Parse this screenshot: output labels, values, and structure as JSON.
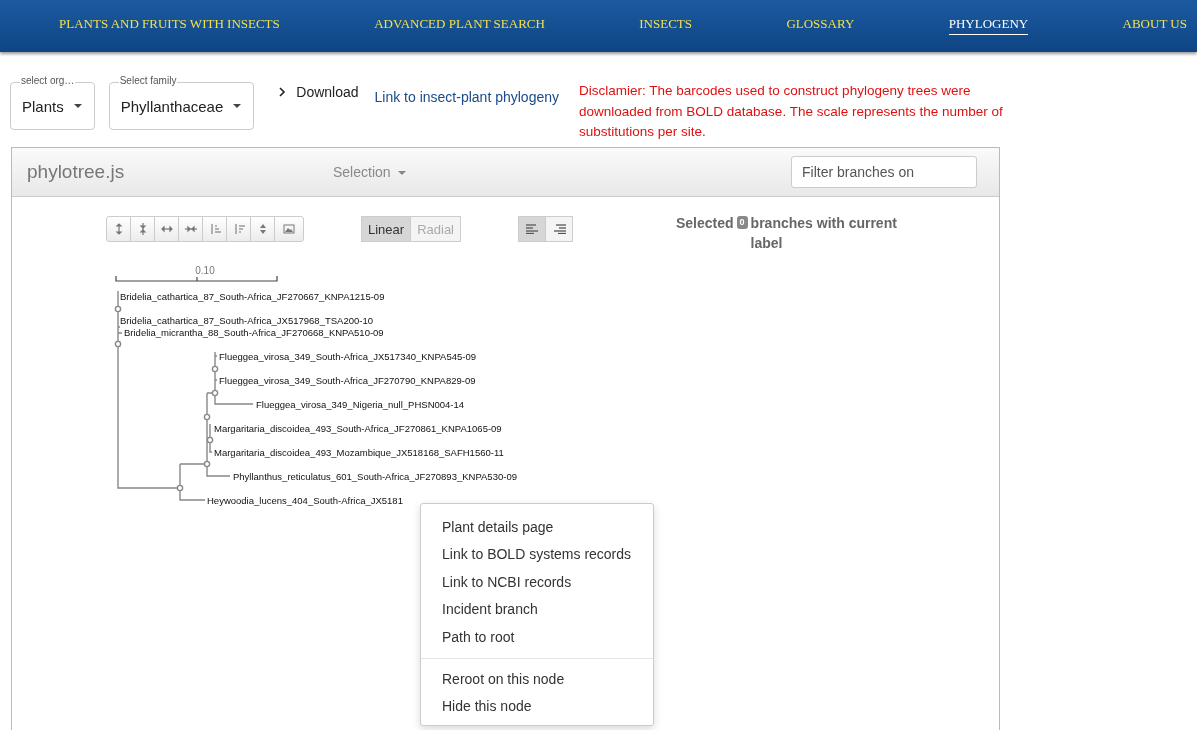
{
  "nav": {
    "items": [
      {
        "label": "PLANTS AND FRUITS WITH INSECTS",
        "selected": false
      },
      {
        "label": "ADVANCED PLANT SEARCH",
        "selected": false
      },
      {
        "label": "INSECTS",
        "selected": false
      },
      {
        "label": "GLOSSARY",
        "selected": false
      },
      {
        "label": "PHYLOGENY",
        "selected": true
      },
      {
        "label": "ABOUT US",
        "selected": false
      }
    ]
  },
  "organism_select": {
    "label": "select org…",
    "value": "Plants"
  },
  "family_select": {
    "label": "Select family",
    "value": "Phyllanthaceae"
  },
  "download": {
    "label": "Download",
    "expanded": false
  },
  "phylogeny_link": "Link to insect-plant phylogeny",
  "disclaimer": "Disclamier: The barcodes used to construct phylogeny trees were downloaded from BOLD database. The scale represents the number of substitutions per site.",
  "panel": {
    "title": "phylotree.js",
    "selection_menu": "Selection",
    "filter": {
      "placeholder": "Filter branches on"
    },
    "layout_toggle": [
      {
        "label": "Linear",
        "selected": true
      },
      {
        "label": "Radial",
        "selected": false
      }
    ],
    "align_toggle": [
      {
        "selected": true
      },
      {
        "selected": false
      }
    ],
    "selected_info": {
      "before": "Selected",
      "count": "0",
      "after": "branches with current label"
    },
    "tree": {
      "scale_label": "0.10",
      "leaves": [
        "Bridelia_cathartica_87_South-Africa_JF270667_KNPA1215-09",
        "Bridelia_cathartica_87_South-Africa_JX517968_TSA200-10",
        "Bridelia_micrantha_88_South-Africa_JF270668_KNPA510-09",
        "Flueggea_virosa_349_South-Africa_JX517340_KNPA545-09",
        "Flueggea_virosa_349_South-Africa_JF270790_KNPA829-09",
        "Flueggea_virosa_349_Nigeria_null_PHSN004-14",
        "Margaritaria_discoidea_493_South-Africa_JF270861_KNPA1065-09",
        "Margaritaria_discoidea_493_Mozambique_JX518168_SAFH1560-11",
        "Phyllanthus_reticulatus_601_South-Africa_JF270893_KNPA530-09",
        "Heywoodia_lucens_404_South-Africa_JX5181"
      ]
    },
    "context_menu": [
      [
        "Plant details page",
        "Link to BOLD systems records",
        "Link to NCBI records",
        "Incident branch",
        "Path to root"
      ],
      [
        "Reroot on this node",
        "Hide this node"
      ]
    ]
  }
}
